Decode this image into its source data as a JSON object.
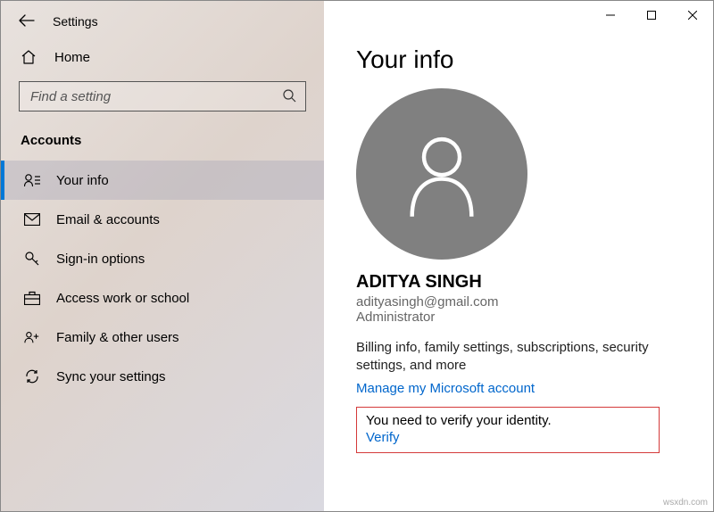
{
  "window": {
    "title": "Settings"
  },
  "sidebar": {
    "home": "Home",
    "search_placeholder": "Find a setting",
    "section": "Accounts",
    "items": [
      {
        "label": "Your info"
      },
      {
        "label": "Email & accounts"
      },
      {
        "label": "Sign-in options"
      },
      {
        "label": "Access work or school"
      },
      {
        "label": "Family & other users"
      },
      {
        "label": "Sync your settings"
      }
    ]
  },
  "content": {
    "heading": "Your info",
    "display_name": "ADITYA SINGH",
    "email": "adityasingh@gmail.com",
    "role": "Administrator",
    "desc": "Billing info, family settings, subscriptions, security settings, and more",
    "manage_link": "Manage my Microsoft account",
    "verify_msg": "You need to verify your identity.",
    "verify_link": "Verify"
  },
  "watermark": "wsxdn.com"
}
